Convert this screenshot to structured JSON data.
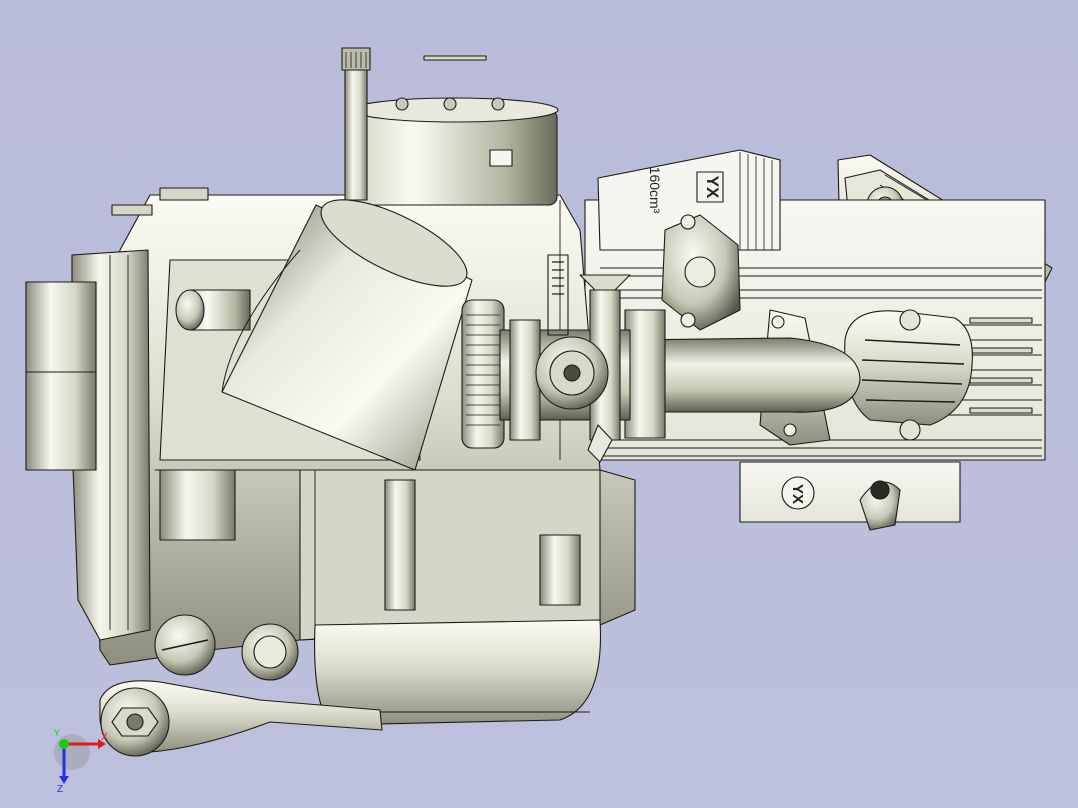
{
  "model": {
    "head_mark": "YX",
    "displacement_label": "160cm³",
    "crankcase_mark": "YX"
  },
  "triad": {
    "x_label": "X",
    "y_label": "Y",
    "z_label": "Z"
  },
  "colors": {
    "background": "#bbbedb",
    "metal_light": "#f4f4ea",
    "metal_mid": "#c9c9b8",
    "metal_dark": "#6f6f60",
    "edge": "#1b1b18",
    "axis_x": "#e01b1b",
    "axis_y": "#1fc61f",
    "axis_z": "#2233dd"
  }
}
